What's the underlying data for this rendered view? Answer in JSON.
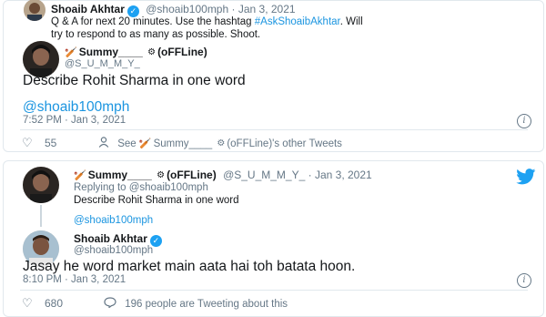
{
  "tweet1": {
    "author_name": "Shoaib Akhtar",
    "author_handle": "@shoaib100mph",
    "date": "Jan 3, 2021",
    "text_line1_a": "Q & A for next 20 minutes. Use the hashtag ",
    "hashtag": "#AskShoaibAkhtar",
    "text_line1_b": ". Will",
    "text_line2": "try to respond to as many as possible. Shoot."
  },
  "quoted": {
    "author_name": "Summy____",
    "author_suffix": "(oFFLine)",
    "author_handle": "@S_U_M_M_Y_"
  },
  "main_tweet": {
    "text": "Describe Rohit Sharma in one word",
    "mention": "@shoaib100mph",
    "timestamp": "7:52 PM · Jan 3, 2021",
    "likes": "55",
    "see_prefix": "See",
    "see_name": "Summy____",
    "see_suffix": "(oFFLine)'s other Tweets"
  },
  "reply_parent": {
    "author_name": "Summy____",
    "author_suffix": "(oFFLine)",
    "author_handle": "@S_U_M_M_Y_",
    "date": "Jan 3, 2021",
    "replying_to": "Replying to @shoaib100mph",
    "text": "Describe Rohit Sharma in one word",
    "mention": "@shoaib100mph"
  },
  "reply": {
    "author_name": "Shoaib Akhtar",
    "author_handle": "@shoaib100mph",
    "text": "Jasay he word market main aata hai toh batata hoon.",
    "timestamp": "8:10 PM · Jan 3, 2021",
    "likes": "680",
    "tweeting_about": "196 people are Tweeting about this"
  },
  "colors": {
    "link": "#1b95e0",
    "twitter_blue": "#1da1f2",
    "gray": "#657786",
    "border": "#e1e8ed"
  },
  "icons": {
    "verified": "verified-check-icon",
    "bat": "cricket-bat-icon",
    "gear": "gear-icon",
    "heart": "heart-icon",
    "person": "person-icon",
    "comment": "comment-bubble-icon",
    "info": "info-icon",
    "bird": "twitter-bird-icon"
  }
}
